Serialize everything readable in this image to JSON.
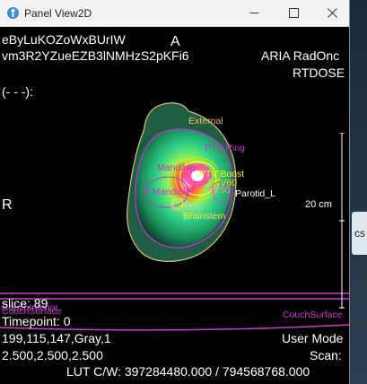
{
  "window": {
    "title": "Panel View2D"
  },
  "overlay": {
    "patient_name": "eByLuKOZoWxBUrIW",
    "patient_id": "vm3R2YZueEZB3lNMHzS2pKFi6",
    "system": "ARIA RadOnc",
    "modality": "RTDOSE",
    "indicator": "(- - -):",
    "orientation_top": "A",
    "orientation_left": "R",
    "scale": "20 cm",
    "slice": "slice:  89",
    "timepoint": "Timepoint: 0",
    "pixel_info": "199,115,147,Gray,1",
    "spacing": "2.500,2.500,2.500",
    "mode": "User Mode",
    "scan": "Scan:",
    "lut": "LUT C/W: 397284480.000 / 794568768.000"
  },
  "structures": {
    "external": "External",
    "ptv_ring": "PTV Ring",
    "mandible": "Mandible",
    "ptv_boost": "PTV Boost",
    "ptv_60": "PTV60",
    "ctv_50": "CTV50",
    "p_mandible": "P Mandible",
    "parotid_l": "Parotid_L",
    "oral": "Oral",
    "brainstem": "Brainstem",
    "couch_interior": "CouchInterior",
    "couch_surface_left": "CouchSurface",
    "couch_surface_right": "CouchSurface"
  },
  "colors": {
    "external": "#e0c060",
    "ptv": "#cc33cc",
    "ptv_boost": "#ffff00",
    "oral": "#7fd0ff",
    "brainstem": "#ffdd55",
    "couch": "#d03ad6",
    "window_bg": "#f3f3f3"
  }
}
